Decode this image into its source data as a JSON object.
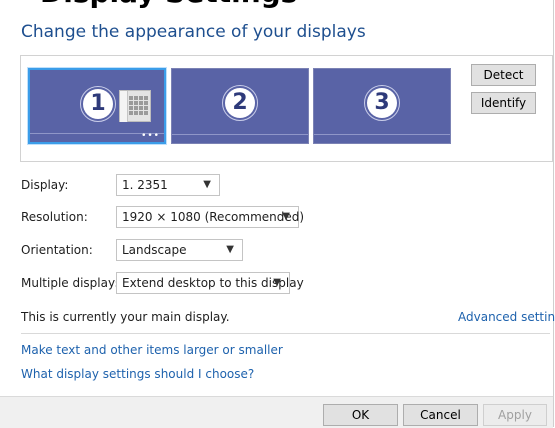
{
  "header": {
    "clipped_title": "Display Settings"
  },
  "title": "Change the appearance of your displays",
  "preview": {
    "monitors": [
      {
        "number": "1",
        "selected": true
      },
      {
        "number": "2",
        "selected": false
      },
      {
        "number": "3",
        "selected": false
      }
    ],
    "dots": "•••",
    "detect_label": "Detect",
    "identify_label": "Identify"
  },
  "settings": {
    "display": {
      "label": "Display:",
      "value": "1. 2351"
    },
    "resolution": {
      "label": "Resolution:",
      "value": "1920 × 1080 (Recommended)"
    },
    "orientation": {
      "label": "Orientation:",
      "value": "Landscape"
    },
    "multiple": {
      "label": "Multiple displays:",
      "value": "Extend desktop to this display"
    }
  },
  "info_text": "This is currently your main display.",
  "links": {
    "advanced": "Advanced settings",
    "text_size": "Make text and other items larger or smaller",
    "help": "What display settings should I choose?"
  },
  "footer": {
    "ok": "OK",
    "cancel": "Cancel",
    "apply": "Apply"
  },
  "colors": {
    "monitor": "#5963a6",
    "selected_border": "#3b9de9",
    "link": "#1e62ad",
    "title": "#1e4f8f"
  }
}
